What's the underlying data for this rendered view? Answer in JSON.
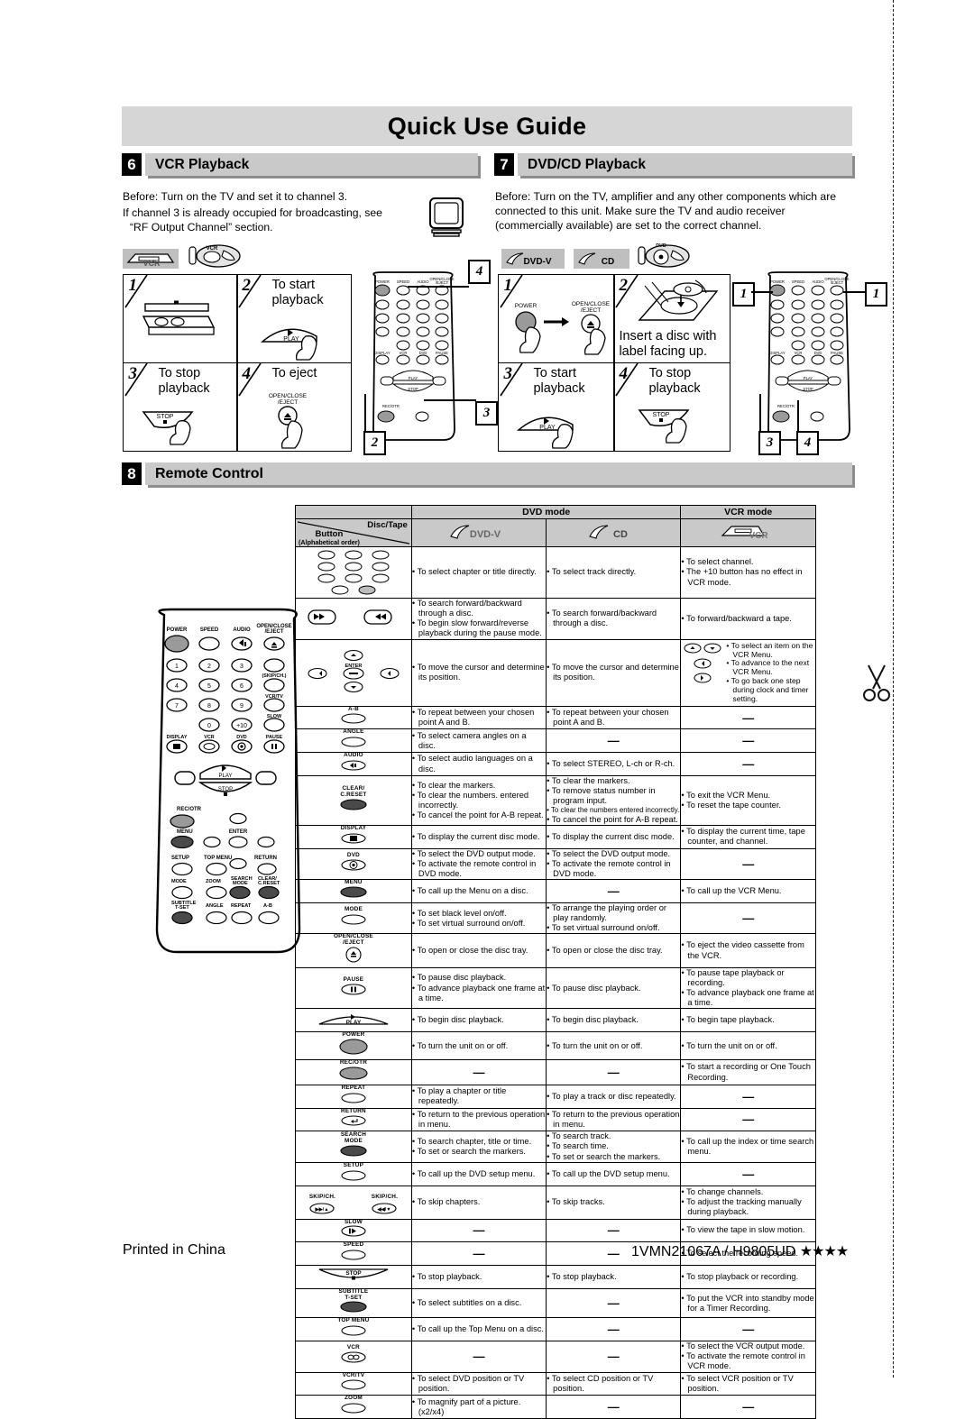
{
  "document": {
    "title": "Quick Use Guide",
    "footer_left": "Printed in China",
    "footer_right": "1VMN21067A / H9805UD",
    "footer_stars": "★★★★"
  },
  "colors": {
    "header_band": "#d6d6d6",
    "section_band": "#c9c9c9",
    "section_shadow": "#8d8d8d",
    "chip_bg": "#bfbfbf",
    "power_button": "#9a9a9a"
  },
  "sections": [
    {
      "number": "6",
      "label": "VCR Playback",
      "before": "Before:  Turn on the TV and set it to channel 3.",
      "bullet": "If channel 3 is already occupied for broadcasting, see “RF Output Channel” section.",
      "chips": [
        "VCR"
      ],
      "steps": [
        {
          "n": "1",
          "text_top": "",
          "text_bottom": ""
        },
        {
          "n": "2",
          "text_top": "To start\nplayback",
          "button": "PLAY"
        },
        {
          "n": "3",
          "text_top": "To stop\nplayback",
          "button": "STOP"
        },
        {
          "n": "4",
          "text_top": "To eject",
          "button": "OPEN/CLOSE\n/EJECT"
        }
      ],
      "callouts": [
        "4",
        "3",
        "2"
      ]
    },
    {
      "number": "7",
      "label": "DVD/CD Playback",
      "before": "Before: Turn on the TV, amplifier and any other components which are connected to this unit. Make sure the TV and audio receiver (commercially available) are set to the correct channel.",
      "chips": [
        "DVD-V",
        "CD"
      ],
      "steps": [
        {
          "n": "1",
          "labels": [
            "POWER",
            "OPEN/CLOSE\n/EJECT"
          ]
        },
        {
          "n": "2",
          "text_bottom": "Insert a disc with\nlabel facing up."
        },
        {
          "n": "3",
          "text_top": "To start\nplayback",
          "button": "PLAY"
        },
        {
          "n": "4",
          "text_top": "To stop\nplayback",
          "button": "STOP"
        }
      ],
      "callouts": [
        "1",
        "1",
        "3",
        "4"
      ]
    },
    {
      "number": "8",
      "label": "Remote Control"
    }
  ],
  "remote_buttons": [
    "POWER",
    "SPEED",
    "AUDIO",
    "OPEN/CLOSE /EJECT",
    "1",
    "2",
    "3",
    "4",
    "5",
    "6",
    "7",
    "8",
    "9",
    "0",
    "+10",
    "SKIP/CH.",
    "VCR/TV",
    "SLOW",
    "DISPLAY",
    "VCR",
    "DVD",
    "PAUSE",
    "PLAY",
    "STOP",
    "REC/OTR",
    "MENU",
    "ENTER",
    "SETUP",
    "TOP MENU",
    "RETURN",
    "MODE",
    "ZOOM",
    "SEARCH MODE",
    "CLEAR/ C.RESET",
    "SUBTITLE T-SET",
    "ANGLE",
    "REPEAT",
    "A-B"
  ],
  "table": {
    "head": {
      "dvd_mode": "DVD mode",
      "vcr_mode": "VCR mode",
      "corner_disc_tape": "Disc/Tape",
      "corner_button": "Button",
      "corner_button_sub": "(Alphabetical order)",
      "media_dvd": "DVD-V",
      "media_cd": "CD",
      "media_vcr": "VCR"
    },
    "dash": "—",
    "rows": [
      {
        "button": "numbers",
        "button_labels": [],
        "dvd": [
          "To select chapter or title directly."
        ],
        "cd": [
          "To select track directly."
        ],
        "vcr": [
          "To select channel.",
          "The +10 button has no effect in VCR mode."
        ]
      },
      {
        "button": "search-fwd-rew",
        "button_labels": [],
        "dvd": [
          "To search forward/backward through a disc.",
          "To begin slow forward/reverse playback during the pause mode."
        ],
        "cd": [
          "To search forward/backward through a disc."
        ],
        "vcr": [
          "To forward/backward a tape."
        ]
      },
      {
        "button": "cursor-enter",
        "button_labels": [
          "ENTER"
        ],
        "dvd": [
          "To move the cursor and determine its position."
        ],
        "cd": [
          "To move the cursor and determine its position."
        ],
        "vcr_special": [
          "To select an item on the VCR Menu.",
          "To advance to the next VCR Menu.",
          "To go back one step during clock and timer setting."
        ]
      },
      {
        "button": "A-B",
        "button_labels": [
          "A-B"
        ],
        "dvd": [
          "To repeat between your chosen point A and B."
        ],
        "cd": [
          "To repeat between your chosen point A and B."
        ],
        "vcr": []
      },
      {
        "button": "ANGLE",
        "button_labels": [
          "ANGLE"
        ],
        "dvd": [
          "To select camera angles on a disc."
        ],
        "cd": [],
        "vcr": []
      },
      {
        "button": "AUDIO",
        "button_labels": [
          "AUDIO"
        ],
        "dvd": [
          "To select audio languages on a disc."
        ],
        "cd": [
          "To select STEREO, L-ch or R-ch."
        ],
        "vcr": []
      },
      {
        "button": "CLEAR/C.RESET",
        "button_labels": [
          "CLEAR/",
          "C.RESET"
        ],
        "dvd": [
          "To clear the markers.",
          "To clear the numbers. entered incorrectly.",
          "To cancel the point for A-B repeat."
        ],
        "cd": [
          "To clear the markers.",
          "To remove status number in program input.",
          "To clear the numbers entered incorrectly.",
          "To cancel the point for A-B repeat."
        ],
        "cd_small_index": 2,
        "vcr": [
          "To exit the VCR Menu.",
          "To reset the tape counter."
        ]
      },
      {
        "button": "DISPLAY",
        "button_labels": [
          "DISPLAY"
        ],
        "dvd": [
          "To display the current disc mode."
        ],
        "cd": [
          "To display the current disc mode."
        ],
        "vcr": [
          "To display the current time, tape counter, and channel."
        ]
      },
      {
        "button": "DVD",
        "button_labels": [
          "DVD"
        ],
        "dvd": [
          "To select the DVD output mode.",
          "To activate the remote control in DVD mode."
        ],
        "cd": [
          "To select the DVD output mode.",
          "To activate the remote control in DVD mode."
        ],
        "vcr": []
      },
      {
        "button": "MENU",
        "button_labels": [
          "MENU"
        ],
        "dvd": [
          "To call up the Menu on a disc."
        ],
        "cd": [],
        "vcr": [
          "To call up the VCR Menu."
        ]
      },
      {
        "button": "MODE",
        "button_labels": [
          "MODE"
        ],
        "dvd": [
          "To set black level on/off.",
          "To set virtual surround on/off."
        ],
        "cd": [
          "To arrange the playing order or play randomly.",
          "To set virtual surround on/off."
        ],
        "vcr": []
      },
      {
        "button": "OPEN/CLOSE /EJECT",
        "button_labels": [
          "OPEN/CLOSE",
          "/EJECT"
        ],
        "dvd": [
          "To open or close the disc tray."
        ],
        "cd": [
          "To open or close the disc tray."
        ],
        "vcr": [
          "To eject the video cassette from the VCR."
        ]
      },
      {
        "button": "PAUSE",
        "button_labels": [
          "PAUSE"
        ],
        "dvd": [
          "To pause disc playback.",
          "To advance playback one frame at a time."
        ],
        "cd": [
          "To pause disc playback."
        ],
        "vcr": [
          "To pause tape playback or recording.",
          "To advance playback one frame at a time."
        ]
      },
      {
        "button": "PLAY",
        "button_labels": [
          "PLAY"
        ],
        "dvd": [
          "To begin disc playback."
        ],
        "cd": [
          "To begin disc playback."
        ],
        "vcr": [
          "To begin tape playback."
        ]
      },
      {
        "button": "POWER",
        "button_labels": [
          "POWER"
        ],
        "dvd": [
          "To turn the unit on or off."
        ],
        "cd": [
          "To turn the unit on or off."
        ],
        "vcr": [
          "To turn the unit on or off."
        ]
      },
      {
        "button": "REC/OTR",
        "button_labels": [
          "REC/OTR"
        ],
        "dvd": [],
        "cd": [],
        "vcr": [
          "To start a recording or One Touch Recording."
        ]
      },
      {
        "button": "REPEAT",
        "button_labels": [
          "REPEAT"
        ],
        "dvd": [
          "To play a chapter or title repeatedly."
        ],
        "cd": [
          "To play a track or disc repeatedly."
        ],
        "vcr": []
      },
      {
        "button": "RETURN",
        "button_labels": [
          "RETURN"
        ],
        "dvd": [
          "To return to the previous operation in menu."
        ],
        "cd": [
          "To return to the previous operation in menu."
        ],
        "vcr": []
      },
      {
        "button": "SEARCH MODE",
        "button_labels": [
          "SEARCH",
          "MODE"
        ],
        "dvd": [
          "To search chapter, title or time.",
          "To set or search the markers."
        ],
        "cd": [
          "To search track.",
          "To search time.",
          "To set or search the markers."
        ],
        "vcr": [
          "To call up the index or time search menu."
        ]
      },
      {
        "button": "SETUP",
        "button_labels": [
          "SETUP"
        ],
        "dvd": [
          "To call up the DVD setup menu."
        ],
        "cd": [
          "To call up the DVD setup menu."
        ],
        "vcr": []
      },
      {
        "button": "SKIP/CH.",
        "button_labels": [
          "SKIP/CH.",
          "SKIP/CH."
        ],
        "dvd": [
          "To skip chapters."
        ],
        "cd": [
          "To skip tracks."
        ],
        "vcr": [
          "To change channels.",
          "To adjust the tracking manually during playback."
        ]
      },
      {
        "button": "SLOW",
        "button_labels": [
          "SLOW"
        ],
        "dvd": [],
        "cd": [],
        "vcr": [
          "To view the tape in slow motion."
        ]
      },
      {
        "button": "SPEED",
        "button_labels": [
          "SPEED"
        ],
        "dvd": [],
        "cd": [],
        "vcr": [
          "To select the recording speed."
        ]
      },
      {
        "button": "STOP",
        "button_labels": [
          "STOP"
        ],
        "dvd": [
          "To stop playback."
        ],
        "cd": [
          "To stop playback."
        ],
        "vcr": [
          "To stop playback or recording."
        ]
      },
      {
        "button": "SUBTITLE T-SET",
        "button_labels": [
          "SUBTITLE",
          "T-SET"
        ],
        "dvd": [
          "To select subtitles on a disc."
        ],
        "cd": [],
        "vcr": [
          "To put the VCR into standby mode for a Timer Recording."
        ]
      },
      {
        "button": "TOP MENU",
        "button_labels": [
          "TOP MENU"
        ],
        "dvd": [
          "To call up the Top Menu on a disc."
        ],
        "cd": [],
        "vcr": []
      },
      {
        "button": "VCR",
        "button_labels": [
          "VCR"
        ],
        "dvd": [],
        "cd": [],
        "vcr": [
          "To select the VCR output mode.",
          "To activate the remote control in VCR mode."
        ]
      },
      {
        "button": "VCR/TV",
        "button_labels": [
          "VCR/TV"
        ],
        "dvd": [
          "To select DVD position or TV position."
        ],
        "cd": [
          "To select CD position or TV position."
        ],
        "vcr": [
          "To select VCR position or TV position."
        ]
      },
      {
        "button": "ZOOM",
        "button_labels": [
          "ZOOM"
        ],
        "dvd": [
          "To magnify part of a picture. (x2/x4)"
        ],
        "cd": [],
        "vcr": []
      }
    ]
  }
}
